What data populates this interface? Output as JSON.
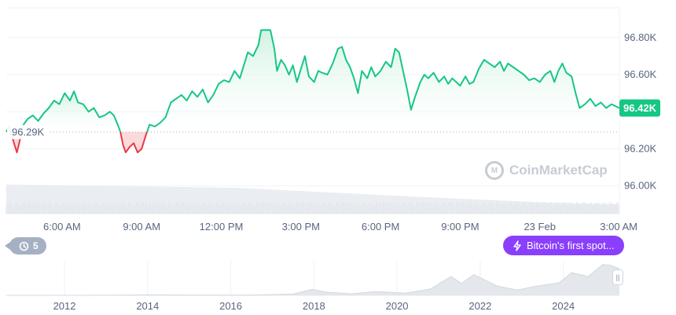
{
  "chart_data": {
    "type": "area",
    "title": "",
    "xlabel": "",
    "ylabel": "",
    "x_ticks": [
      "6:00 AM",
      "9:00 AM",
      "12:00 PM",
      "3:00 PM",
      "6:00 PM",
      "9:00 PM",
      "23 Feb",
      "3:00 AM"
    ],
    "y_ticks": [
      "96.80K",
      "96.60K",
      "96.40K",
      "96.20K",
      "96.00K"
    ],
    "y_tick_values": [
      96800,
      96600,
      96400,
      96200,
      96000
    ],
    "ylim": [
      95850,
      96960
    ],
    "x_range_hours": [
      3.9,
      27.0
    ],
    "baseline": {
      "value": 96290,
      "label": "96.29K"
    },
    "current_price": {
      "value": 96420,
      "label": "96.42K"
    },
    "series": [
      {
        "points": [
          [
            3.9,
            96290
          ],
          [
            4.0,
            96320
          ],
          [
            4.15,
            96250
          ],
          [
            4.3,
            96180
          ],
          [
            4.4,
            96240
          ],
          [
            4.55,
            96330
          ],
          [
            4.7,
            96360
          ],
          [
            4.9,
            96380
          ],
          [
            5.1,
            96350
          ],
          [
            5.3,
            96390
          ],
          [
            5.5,
            96420
          ],
          [
            5.7,
            96460
          ],
          [
            5.9,
            96440
          ],
          [
            6.1,
            96500
          ],
          [
            6.3,
            96460
          ],
          [
            6.45,
            96510
          ],
          [
            6.6,
            96450
          ],
          [
            6.8,
            96440
          ],
          [
            7.0,
            96400
          ],
          [
            7.2,
            96420
          ],
          [
            7.4,
            96370
          ],
          [
            7.6,
            96380
          ],
          [
            7.8,
            96400
          ],
          [
            7.95,
            96380
          ],
          [
            8.1,
            96330
          ],
          [
            8.2,
            96290
          ],
          [
            8.3,
            96220
          ],
          [
            8.4,
            96180
          ],
          [
            8.55,
            96210
          ],
          [
            8.7,
            96230
          ],
          [
            8.85,
            96180
          ],
          [
            9.0,
            96200
          ],
          [
            9.15,
            96270
          ],
          [
            9.3,
            96330
          ],
          [
            9.5,
            96320
          ],
          [
            9.7,
            96340
          ],
          [
            9.9,
            96370
          ],
          [
            10.1,
            96450
          ],
          [
            10.3,
            96470
          ],
          [
            10.5,
            96490
          ],
          [
            10.7,
            96460
          ],
          [
            10.9,
            96510
          ],
          [
            11.1,
            96480
          ],
          [
            11.3,
            96520
          ],
          [
            11.5,
            96450
          ],
          [
            11.7,
            96490
          ],
          [
            11.9,
            96550
          ],
          [
            12.1,
            96570
          ],
          [
            12.3,
            96560
          ],
          [
            12.5,
            96620
          ],
          [
            12.7,
            96580
          ],
          [
            12.85,
            96650
          ],
          [
            13.0,
            96720
          ],
          [
            13.2,
            96700
          ],
          [
            13.4,
            96760
          ],
          [
            13.5,
            96840
          ],
          [
            13.7,
            96840
          ],
          [
            13.85,
            96840
          ],
          [
            14.0,
            96740
          ],
          [
            14.1,
            96620
          ],
          [
            14.25,
            96680
          ],
          [
            14.4,
            96650
          ],
          [
            14.55,
            96600
          ],
          [
            14.7,
            96650
          ],
          [
            14.85,
            96560
          ],
          [
            15.0,
            96630
          ],
          [
            15.15,
            96700
          ],
          [
            15.3,
            96590
          ],
          [
            15.5,
            96560
          ],
          [
            15.65,
            96620
          ],
          [
            15.8,
            96610
          ],
          [
            16.0,
            96600
          ],
          [
            16.2,
            96660
          ],
          [
            16.4,
            96740
          ],
          [
            16.55,
            96750
          ],
          [
            16.7,
            96680
          ],
          [
            16.85,
            96640
          ],
          [
            17.0,
            96580
          ],
          [
            17.15,
            96500
          ],
          [
            17.3,
            96620
          ],
          [
            17.5,
            96580
          ],
          [
            17.65,
            96640
          ],
          [
            17.8,
            96590
          ],
          [
            18.0,
            96620
          ],
          [
            18.2,
            96670
          ],
          [
            18.4,
            96640
          ],
          [
            18.55,
            96740
          ],
          [
            18.7,
            96720
          ],
          [
            18.85,
            96620
          ],
          [
            19.0,
            96520
          ],
          [
            19.15,
            96410
          ],
          [
            19.3,
            96480
          ],
          [
            19.5,
            96560
          ],
          [
            19.65,
            96600
          ],
          [
            19.8,
            96580
          ],
          [
            20.0,
            96610
          ],
          [
            20.2,
            96560
          ],
          [
            20.4,
            96590
          ],
          [
            20.55,
            96550
          ],
          [
            20.7,
            96580
          ],
          [
            20.85,
            96560
          ],
          [
            21.0,
            96540
          ],
          [
            21.2,
            96590
          ],
          [
            21.35,
            96550
          ],
          [
            21.5,
            96560
          ],
          [
            21.7,
            96630
          ],
          [
            21.9,
            96680
          ],
          [
            22.1,
            96660
          ],
          [
            22.3,
            96640
          ],
          [
            22.5,
            96670
          ],
          [
            22.65,
            96620
          ],
          [
            22.8,
            96660
          ],
          [
            23.0,
            96640
          ],
          [
            23.2,
            96620
          ],
          [
            23.4,
            96600
          ],
          [
            23.6,
            96570
          ],
          [
            23.8,
            96580
          ],
          [
            24.0,
            96560
          ],
          [
            24.2,
            96600
          ],
          [
            24.4,
            96620
          ],
          [
            24.55,
            96560
          ],
          [
            24.7,
            96620
          ],
          [
            24.85,
            96660
          ],
          [
            25.0,
            96610
          ],
          [
            25.2,
            96590
          ],
          [
            25.35,
            96500
          ],
          [
            25.5,
            96420
          ],
          [
            25.7,
            96440
          ],
          [
            25.9,
            96470
          ],
          [
            26.1,
            96430
          ],
          [
            26.3,
            96450
          ],
          [
            26.5,
            96420
          ],
          [
            26.7,
            96440
          ],
          [
            26.85,
            96430
          ],
          [
            27.0,
            96420
          ]
        ]
      }
    ],
    "overview": {
      "x_ticks": [
        "2012",
        "2014",
        "2016",
        "2018",
        "2020",
        "2022",
        "2024"
      ],
      "x_range_years": [
        2010.6,
        2025.35
      ],
      "points": [
        [
          2010.6,
          0.0
        ],
        [
          2011.5,
          0.0
        ],
        [
          2012.5,
          0.0
        ],
        [
          2013.6,
          0.01
        ],
        [
          2014.0,
          0.02
        ],
        [
          2015.0,
          0.01
        ],
        [
          2016.5,
          0.01
        ],
        [
          2017.5,
          0.04
        ],
        [
          2017.96,
          0.19
        ],
        [
          2018.3,
          0.1
        ],
        [
          2018.9,
          0.05
        ],
        [
          2019.5,
          0.12
        ],
        [
          2020.2,
          0.07
        ],
        [
          2020.8,
          0.2
        ],
        [
          2021.3,
          0.6
        ],
        [
          2021.55,
          0.38
        ],
        [
          2021.85,
          0.66
        ],
        [
          2022.4,
          0.3
        ],
        [
          2022.9,
          0.17
        ],
        [
          2023.3,
          0.28
        ],
        [
          2023.9,
          0.4
        ],
        [
          2024.2,
          0.72
        ],
        [
          2024.6,
          0.6
        ],
        [
          2024.95,
          0.98
        ],
        [
          2025.15,
          0.95
        ],
        [
          2025.35,
          0.85
        ]
      ]
    }
  },
  "events_button": {
    "icon": "history-icon",
    "count": "5"
  },
  "event_marker": {
    "icon": "lightning-icon",
    "label": "Bitcoin's first spot..."
  },
  "watermark": {
    "text": "CoinMarketCap"
  },
  "handle": {
    "icon": "pause-grip-icon",
    "glyph": "||"
  },
  "colors": {
    "up": "#16c784",
    "down": "#ea3943",
    "up_fill_top": "#c8f0dd",
    "badge_up": "#16c784",
    "event": "#8a3ffc",
    "grid": "#eff2f5"
  }
}
